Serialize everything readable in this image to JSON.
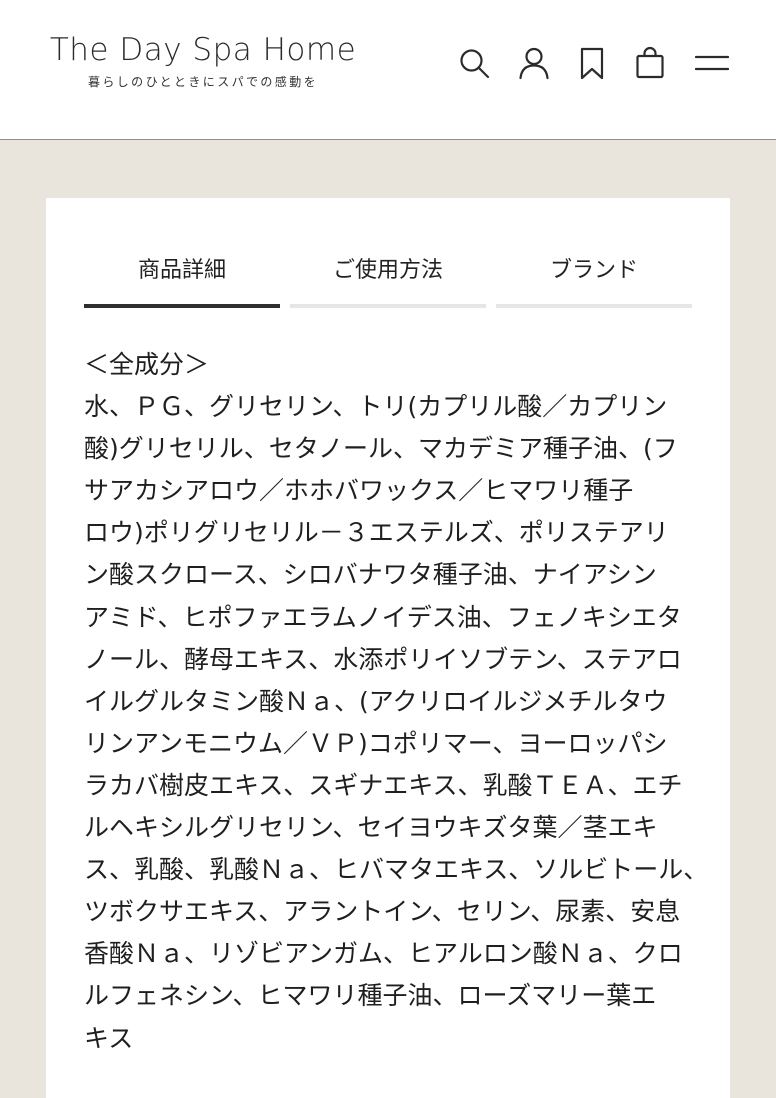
{
  "header": {
    "logo_title": "The Day Spa Home",
    "logo_tagline": "暮らしのひとときにスパでの感動を",
    "icons": [
      "search-icon",
      "user-icon",
      "bookmark-icon",
      "bag-icon",
      "menu-icon"
    ]
  },
  "tabs": [
    {
      "label": "商品詳細",
      "active": true
    },
    {
      "label": "ご使用方法",
      "active": false
    },
    {
      "label": "ブランド",
      "active": false
    }
  ],
  "ingredients": {
    "heading": "＜全成分＞",
    "lines": [
      "水、ＰＧ、グリセリン、トリ(カプリル酸／カプリン",
      "酸)グリセリル、セタノール、マカデミア種子油、(フ",
      "サアカシアロウ／ホホバワックス／ヒマワリ種子",
      "ロウ)ポリグリセリル－３エステルズ、ポリステアリ",
      "ン酸スクロース、シロバナワタ種子油、ナイアシン",
      "アミド、ヒポファエラムノイデス油、フェノキシエタ",
      "ノール、酵母エキス、水添ポリイソブテン、ステアロ",
      "イルグルタミン酸Ｎａ、(アクリロイルジメチルタウ",
      "リンアンモニウム／ＶＰ)コポリマー、ヨーロッパシ",
      "ラカバ樹皮エキス、スギナエキス、乳酸ＴＥＡ、エチ",
      "ルヘキシルグリセリン、セイヨウキズタ葉／茎エキ",
      "ス、乳酸、乳酸Ｎａ、ヒバマタエキス、ソルビトール、",
      "ツボクサエキス、アラントイン、セリン、尿素、安息",
      "香酸Ｎａ、リゾビアンガム、ヒアルロン酸Ｎａ、クロ",
      "ルフェネシン、ヒマワリ種子油、ローズマリー葉エ",
      "キス"
    ]
  }
}
